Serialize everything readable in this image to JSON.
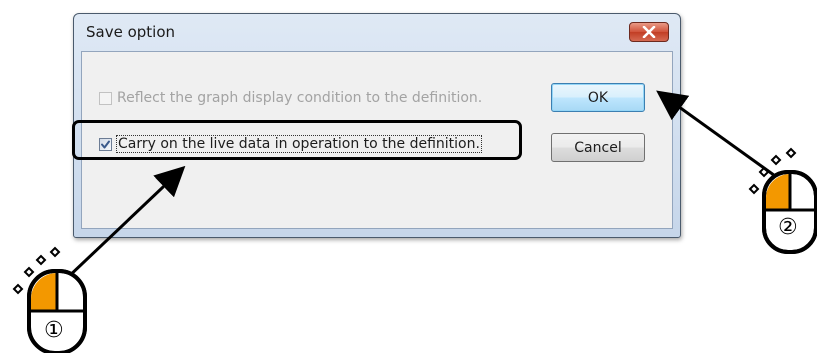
{
  "dialog": {
    "title": "Save option",
    "checkbox_graph": {
      "label": "Reflect the graph display condition to the definition.",
      "checked": false,
      "enabled": false
    },
    "checkbox_live": {
      "label": "Carry on the live data in operation to the definition.",
      "checked": true,
      "enabled": true
    },
    "ok_label": "OK",
    "cancel_label": "Cancel",
    "close_icon": "close-x-icon"
  },
  "annotations": {
    "step1_number": "①",
    "step2_number": "②",
    "mouse_icon": "mouse-left-click-icon",
    "colors": {
      "mouse_button": "#f39800",
      "highlight_border": "#000000"
    }
  }
}
